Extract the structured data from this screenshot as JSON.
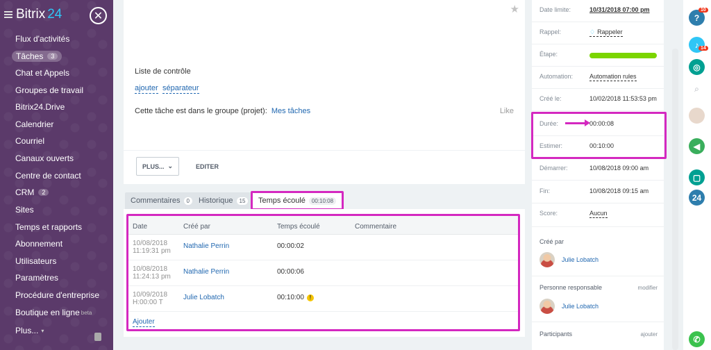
{
  "sidebar": {
    "logo": "Bitrix",
    "logo_num": "24",
    "items": [
      {
        "label": "Flux d'activités"
      },
      {
        "label": "Tâches",
        "count": "3"
      },
      {
        "label": "Chat et Appels"
      },
      {
        "label": "Groupes de travail"
      },
      {
        "label": "Bitrix24.Drive"
      },
      {
        "label": "Calendrier"
      },
      {
        "label": "Courriel"
      },
      {
        "label": "Canaux ouverts"
      },
      {
        "label": "Centre de contact"
      },
      {
        "label": "CRM",
        "count": "2"
      },
      {
        "label": "Sites"
      },
      {
        "label": "Temps et rapports"
      },
      {
        "label": "Abonnement"
      },
      {
        "label": "Utilisateurs"
      },
      {
        "label": "Paramètres"
      },
      {
        "label": "Procédure d'entreprise"
      },
      {
        "label": "Boutique en ligne",
        "suffix": "beta"
      },
      {
        "label": "Plus..."
      }
    ]
  },
  "task": {
    "checklist_title": "Liste de contrôle",
    "checklist_add": "ajouter",
    "checklist_separator": "séparateur",
    "group_text": "Cette tâche est dans le groupe (projet):",
    "group_link": "Mes tâches",
    "like": "Like",
    "plus_button": "PLUS...",
    "edit_button": "EDITER"
  },
  "tabs": [
    {
      "label": "Commentaires",
      "count": "0"
    },
    {
      "label": "Historique",
      "count": "15"
    },
    {
      "label": "Temps écoulé",
      "count": "00:10:08"
    }
  ],
  "time_table": {
    "headers": [
      "Date",
      "Créé par",
      "Temps écoulé",
      "Commentaire"
    ],
    "rows": [
      {
        "date": "10/08/2018",
        "time": "11:19:31 pm",
        "author": "Nathalie Perrin",
        "elapsed": "00:00:02"
      },
      {
        "date": "10/08/2018",
        "time": "11:24:13 pm",
        "author": "Nathalie Perrin",
        "elapsed": "00:00:06"
      },
      {
        "date": "10/09/2018",
        "time": "H:00:00 T",
        "author": "Julie Lobatch",
        "elapsed": "00:10:00"
      }
    ],
    "add_link": "Ajouter"
  },
  "info": {
    "deadline_label": "Date limite:",
    "deadline_value": "10/31/2018 07:00 pm",
    "reminder_label": "Rappel:",
    "reminder_value": "Rappeler",
    "stage_label": "Étape:",
    "automation_label": "Automation:",
    "automation_value": "Automation rules",
    "created_label": "Créé le:",
    "created_value": "10/02/2018 11:53:53 pm",
    "duration_label": "Durée:",
    "duration_value": "00:00:08",
    "estimate_label": "Estimer:",
    "estimate_value": "00:10:00",
    "start_label": "Démarrer:",
    "start_value": "10/08/2018 09:00 am",
    "end_label": "Fin:",
    "end_value": "10/08/2018 09:15 am",
    "score_label": "Score:",
    "score_value": "Aucun",
    "created_by_label": "Créé par",
    "created_by_name": "Julie Lobatch",
    "responsible_label": "Personne responsable",
    "responsible_modify": "modifier",
    "responsible_name": "Julie Lobatch",
    "participants_label": "Participants",
    "participants_add": "ajouter"
  },
  "right_strip": {
    "help_badge": "10",
    "notif_badge": "14",
    "b24": "24"
  },
  "colors": {
    "highlight": "#d428c0",
    "link": "#2067b0",
    "stage": "#7bd500",
    "sidebar": "#5b3a6a"
  }
}
